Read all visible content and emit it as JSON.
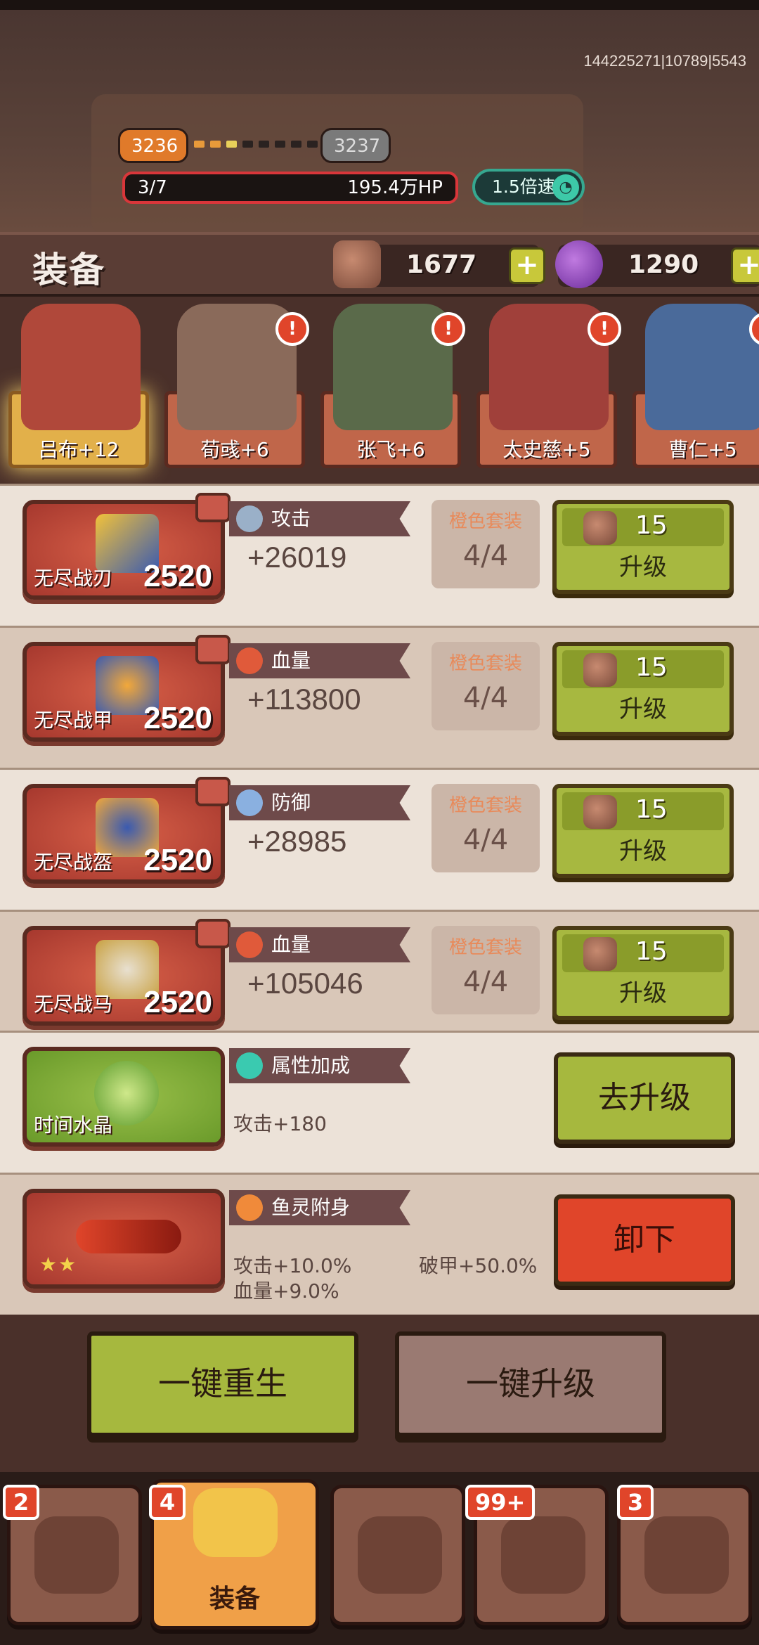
{
  "debug_text": "144225271|10789|5543",
  "wave": {
    "current": "3236",
    "next": "3237",
    "progress_dots": 8,
    "dots_done": 2
  },
  "hp": {
    "stage": "3/7",
    "value": "195.4万HP"
  },
  "speed": {
    "label": "1.5倍速"
  },
  "equip_title": "装备",
  "resources": {
    "stone": "1677",
    "gem": "1290"
  },
  "heroes": [
    {
      "name": "吕布+12",
      "selected": true,
      "alert": false
    },
    {
      "name": "荀彧+6",
      "selected": false,
      "alert": true
    },
    {
      "name": "张飞+6",
      "selected": false,
      "alert": true
    },
    {
      "name": "太史慈+5",
      "selected": false,
      "alert": true
    },
    {
      "name": "曹仁+5",
      "selected": false,
      "alert": true
    }
  ],
  "items": [
    {
      "name": "无尽战刃",
      "level": "2520",
      "stat": "攻击",
      "value": "+26019",
      "set_label": "橙色套装",
      "set_count": "4/4",
      "cost": "15",
      "upgrade": "升级"
    },
    {
      "name": "无尽战甲",
      "level": "2520",
      "stat": "血量",
      "value": "+113800",
      "set_label": "橙色套装",
      "set_count": "4/4",
      "cost": "15",
      "upgrade": "升级"
    },
    {
      "name": "无尽战盔",
      "level": "2520",
      "stat": "防御",
      "value": "+28985",
      "set_label": "橙色套装",
      "set_count": "4/4",
      "cost": "15",
      "upgrade": "升级"
    },
    {
      "name": "无尽战马",
      "level": "2520",
      "stat": "血量",
      "value": "+105046",
      "set_label": "橙色套装",
      "set_count": "4/4",
      "cost": "15",
      "upgrade": "升级"
    }
  ],
  "crystal": {
    "name": "时间水晶",
    "stat": "属性加成",
    "line1": "攻击+180",
    "button": "去升级"
  },
  "fish": {
    "stat": "鱼灵附身",
    "line1": "攻击+10.0%",
    "line2": "血量+9.0%",
    "line3": "破甲+50.0%",
    "button": "卸下",
    "stars": "★★"
  },
  "actions": {
    "rebirth": "一键重生",
    "upgrade_all": "一键升级"
  },
  "tabs": [
    {
      "label": "",
      "badge": "2",
      "active": false
    },
    {
      "label": "装备",
      "badge": "4",
      "active": true
    },
    {
      "label": "",
      "badge": "",
      "active": false
    },
    {
      "label": "",
      "badge": "99+",
      "active": false
    },
    {
      "label": "",
      "badge": "3",
      "active": false
    }
  ],
  "colors": {
    "accent_green": "#a6b83e",
    "accent_red": "#e0452a",
    "accent_orange": "#f0a048"
  }
}
